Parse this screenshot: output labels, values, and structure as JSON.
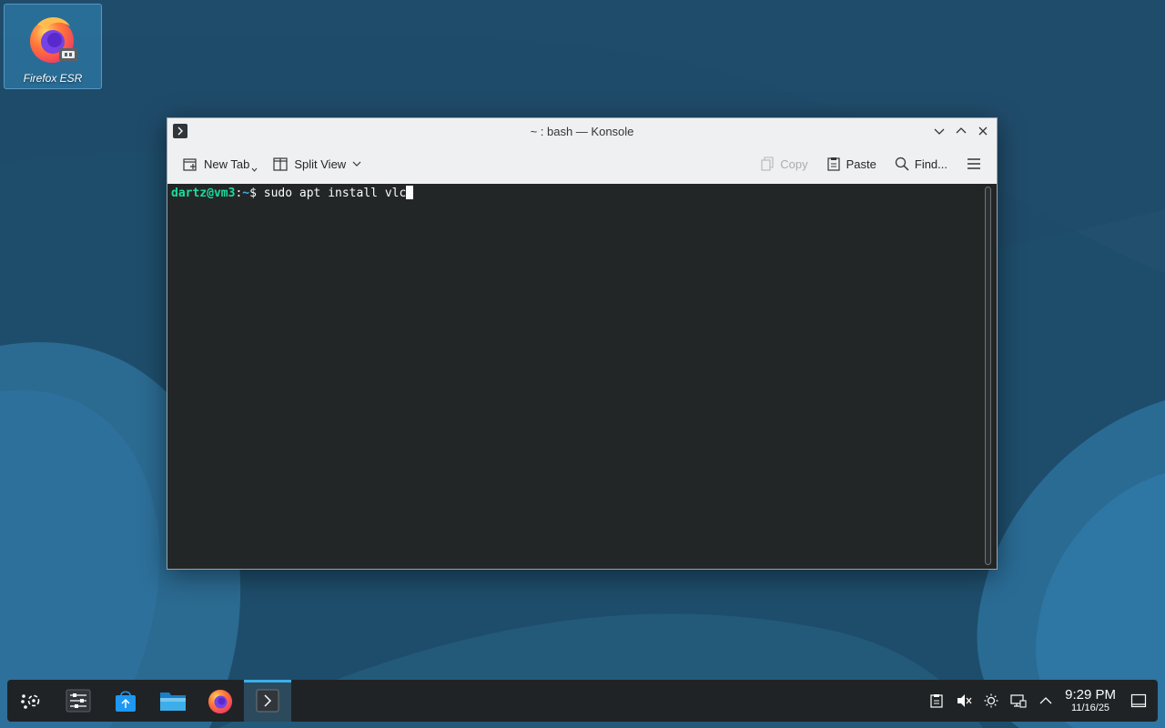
{
  "desktop": {
    "icons": [
      {
        "label": "Firefox ESR",
        "icon": "firefox-icon"
      }
    ]
  },
  "window": {
    "title": "~ : bash — Konsole",
    "toolbar": {
      "new_tab": "New Tab",
      "split_view": "Split View",
      "copy": "Copy",
      "paste": "Paste",
      "find": "Find..."
    },
    "terminal": {
      "prompt_user": "dartz@vm3",
      "prompt_sep": ":",
      "prompt_path": "~",
      "prompt_symbol": "$ ",
      "command": "sudo apt install vlc"
    }
  },
  "taskbar": {
    "apps": [
      {
        "name": "application-launcher",
        "icon": "kde-launcher-icon"
      },
      {
        "name": "system-settings",
        "icon": "settings-sliders-icon"
      },
      {
        "name": "discover",
        "icon": "store-bag-icon"
      },
      {
        "name": "dolphin",
        "icon": "folder-icon"
      },
      {
        "name": "firefox",
        "icon": "firefox-icon"
      },
      {
        "name": "konsole",
        "icon": "terminal-icon",
        "active": true
      }
    ],
    "clock": {
      "time": "9:29 PM",
      "date": "11/16/25"
    }
  },
  "colors": {
    "accent": "#3daee9",
    "prompt_user": "#1cdc9a",
    "terminal_bg": "#232627",
    "taskbar_bg": "#202326"
  }
}
